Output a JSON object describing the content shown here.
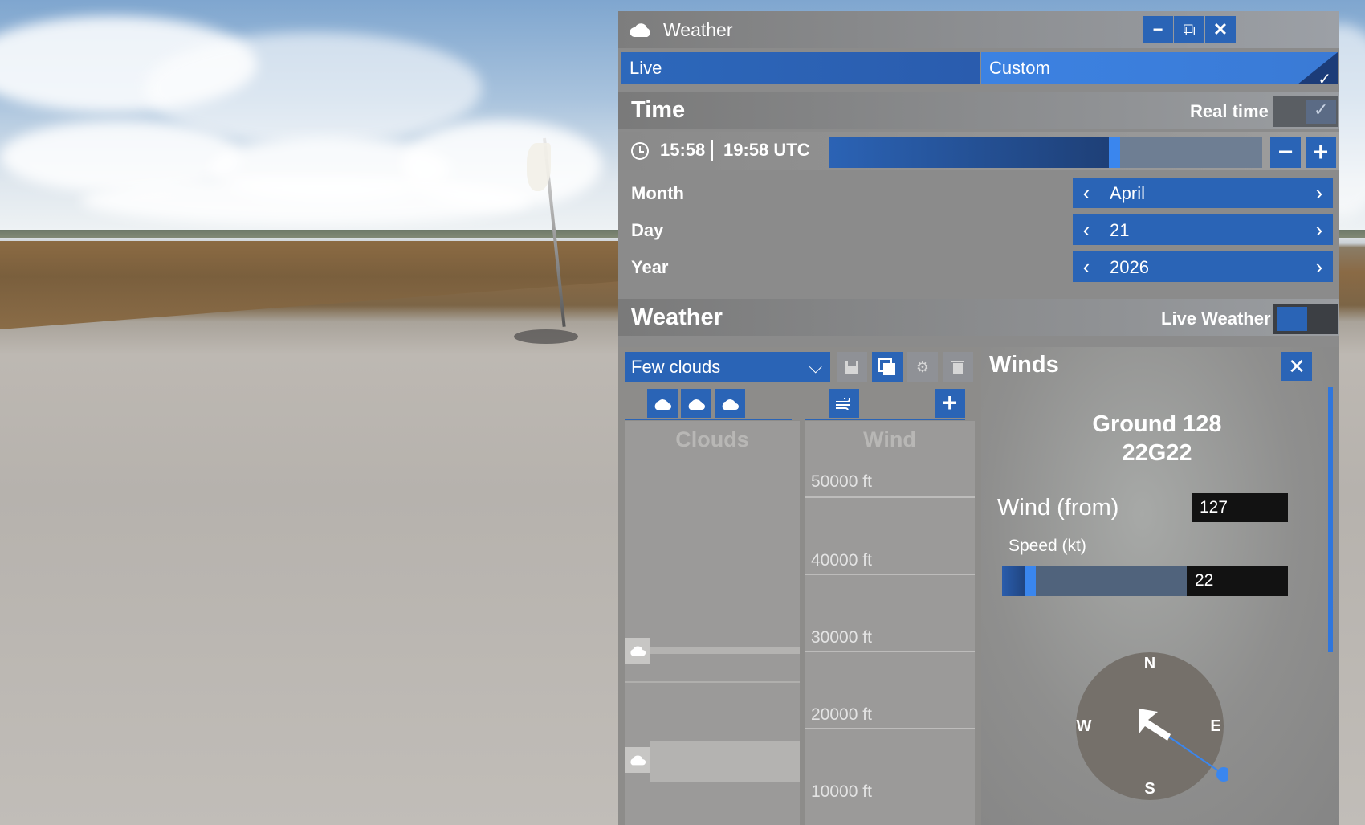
{
  "window": {
    "title": "Weather",
    "buttons": {
      "minimize": "−",
      "popout": "⧉",
      "close": "✕"
    }
  },
  "mode_tabs": [
    {
      "label": "Live",
      "selected": false
    },
    {
      "label": "Custom",
      "selected": true
    }
  ],
  "time_section": {
    "title": "Time",
    "real_time_label": "Real time",
    "real_time_enabled": true,
    "local_time": "15:58",
    "utc_time": "19:58 UTC",
    "time_of_day_fraction": 0.66,
    "minus": "−",
    "plus": "+",
    "month_label": "Month",
    "month_value": "April",
    "day_label": "Day",
    "day_value": "21",
    "year_label": "Year",
    "year_value": "2026",
    "prev_arrow": "‹",
    "next_arrow": "›"
  },
  "weather_section": {
    "title": "Weather",
    "live_weather_label": "Live Weather",
    "live_weather_enabled": false,
    "preset": "Few clouds",
    "preset_chevron": "⌵",
    "tools": [
      "save-icon",
      "copy-icon",
      "gear-icon",
      "trash-icon"
    ],
    "cloud_layer_tabs": 3,
    "add": "+",
    "clouds_title": "Clouds",
    "wind_title": "Wind",
    "altitudes": [
      "50000 ft",
      "40000 ft",
      "30000 ft",
      "20000 ft",
      "10000 ft"
    ]
  },
  "winds": {
    "title": "Winds",
    "close": "✕",
    "ground_line1": "Ground 128",
    "ground_line2": "22G22",
    "wind_from_label": "Wind (from)",
    "wind_from_value": "127",
    "speed_label": "Speed (kt)",
    "speed_value": "22",
    "speed_fraction": 0.15,
    "compass": {
      "n": "N",
      "e": "E",
      "s": "S",
      "w": "W"
    }
  },
  "colors": {
    "accent": "#2a64b6",
    "accent_bright": "#3a86ee",
    "panel_bg": "#8b8b8b"
  }
}
